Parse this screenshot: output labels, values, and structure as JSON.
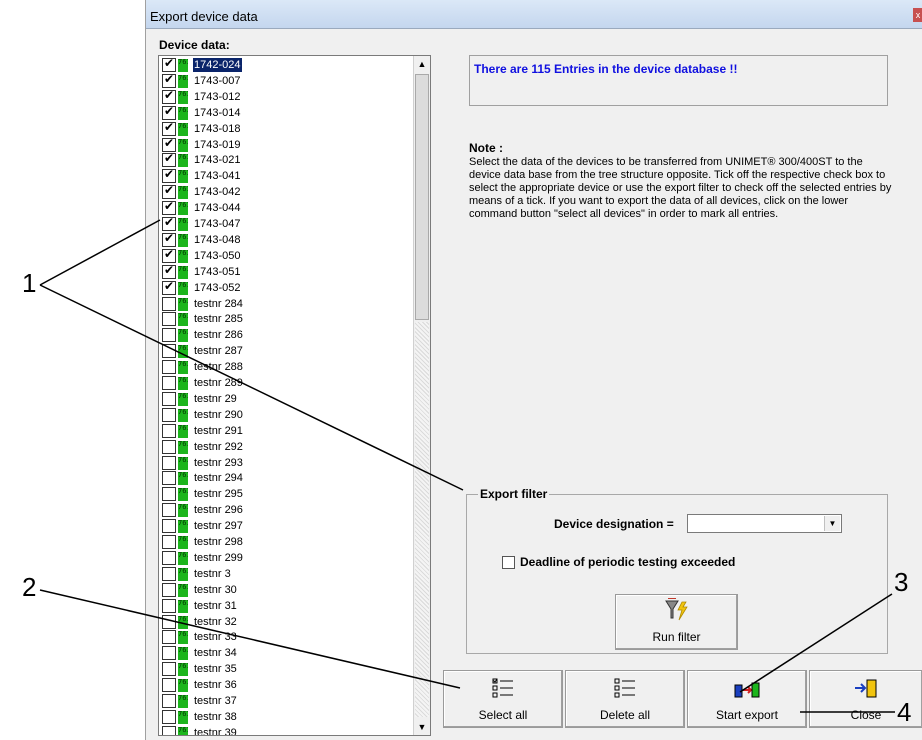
{
  "window": {
    "title": "Export device data",
    "close_glyph": "x"
  },
  "tree": {
    "label": "Device data:",
    "items": [
      {
        "label": "1742-024",
        "checked": true,
        "selected": true
      },
      {
        "label": "1743-007",
        "checked": true
      },
      {
        "label": "1743-012",
        "checked": true
      },
      {
        "label": "1743-014",
        "checked": true
      },
      {
        "label": "1743-018",
        "checked": true
      },
      {
        "label": "1743-019",
        "checked": true
      },
      {
        "label": "1743-021",
        "checked": true
      },
      {
        "label": "1743-041",
        "checked": true
      },
      {
        "label": "1743-042",
        "checked": true
      },
      {
        "label": "1743-044",
        "checked": true
      },
      {
        "label": "1743-047",
        "checked": true
      },
      {
        "label": "1743-048",
        "checked": true
      },
      {
        "label": "1743-050",
        "checked": true
      },
      {
        "label": "1743-051",
        "checked": true
      },
      {
        "label": "1743-052",
        "checked": true
      },
      {
        "label": "testnr 284",
        "checked": false
      },
      {
        "label": "testnr 285",
        "checked": false
      },
      {
        "label": "testnr 286",
        "checked": false
      },
      {
        "label": "testnr 287",
        "checked": false
      },
      {
        "label": "testnr 288",
        "checked": false
      },
      {
        "label": "testnr 289",
        "checked": false
      },
      {
        "label": "testnr 29",
        "checked": false
      },
      {
        "label": "testnr 290",
        "checked": false
      },
      {
        "label": "testnr 291",
        "checked": false
      },
      {
        "label": "testnr 292",
        "checked": false
      },
      {
        "label": "testnr 293",
        "checked": false
      },
      {
        "label": "testnr 294",
        "checked": false
      },
      {
        "label": "testnr 295",
        "checked": false
      },
      {
        "label": "testnr 296",
        "checked": false
      },
      {
        "label": "testnr 297",
        "checked": false
      },
      {
        "label": "testnr 298",
        "checked": false
      },
      {
        "label": "testnr 299",
        "checked": false
      },
      {
        "label": "testnr 3",
        "checked": false
      },
      {
        "label": "testnr 30",
        "checked": false
      },
      {
        "label": "testnr 31",
        "checked": false
      },
      {
        "label": "testnr 32",
        "checked": false
      },
      {
        "label": "testnr 33",
        "checked": false
      },
      {
        "label": "testnr 34",
        "checked": false
      },
      {
        "label": "testnr 35",
        "checked": false
      },
      {
        "label": "testnr 36",
        "checked": false
      },
      {
        "label": "testnr 37",
        "checked": false
      },
      {
        "label": "testnr 38",
        "checked": false
      },
      {
        "label": "testnr 39",
        "checked": false
      }
    ],
    "item_icon": "device-761-icon",
    "item_icon_text": "761"
  },
  "info": {
    "text": "There are 115 Entries in the device database !!",
    "color": "#1010e0"
  },
  "note": {
    "heading": "Note :",
    "body": "Select the data of the devices to be transferred from UNIMET® 300/400ST to the device data base from the tree structure opposite. Tick off the respective check box to select the appropriate device or use the export filter to check off the selected entries by means of a tick. If you want to export the data of all devices, click on the lower command button \"select all devices\" in order to mark all entries."
  },
  "filter": {
    "legend": "Export filter",
    "designation_label": "Device designation =",
    "designation_value": "",
    "deadline_label": "Deadline of periodic testing exceeded",
    "deadline_checked": false,
    "run_label": "Run filter",
    "run_icon": "funnel-lightning-icon"
  },
  "buttons": {
    "select_all": "Select all",
    "delete_all": "Delete all",
    "start_export": "Start export",
    "close": "Close"
  },
  "annotations": {
    "n1": "1",
    "n2": "2",
    "n3": "3",
    "n4": "4"
  }
}
